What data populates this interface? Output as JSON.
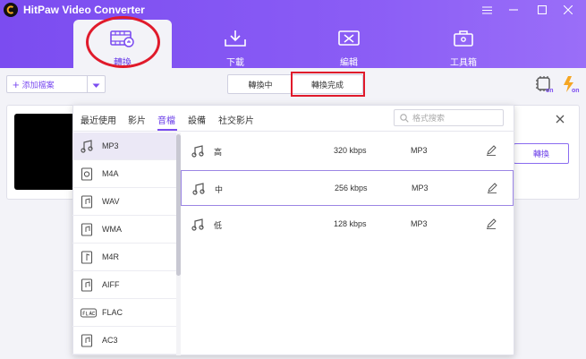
{
  "app": {
    "title": "HitPaw Video Converter"
  },
  "nav": {
    "tabs": [
      {
        "label": "轉換",
        "icon": "convert-film-icon",
        "active": true
      },
      {
        "label": "下載",
        "icon": "download-tray-icon",
        "active": false
      },
      {
        "label": "編輯",
        "icon": "edit-scissors-icon",
        "active": false
      },
      {
        "label": "工具箱",
        "icon": "toolbox-icon",
        "active": false
      }
    ]
  },
  "toolbar": {
    "add_file_label": "添加檔案",
    "segments": [
      "轉換中",
      "轉換完成"
    ],
    "active_segment": "轉換完成"
  },
  "card": {
    "convert_label": "轉換"
  },
  "format_popup": {
    "tabs": [
      "最近使用",
      "影片",
      "音檔",
      "設備",
      "社交影片"
    ],
    "active_tab": "音檔",
    "search_placeholder": "格式搜索",
    "formats": [
      {
        "name": "MP3",
        "icon": "music-note-icon",
        "active": true
      },
      {
        "name": "M4A",
        "icon": "m4a-file-icon",
        "active": false
      },
      {
        "name": "WAV",
        "icon": "wav-file-icon",
        "active": false
      },
      {
        "name": "WMA",
        "icon": "wma-file-icon",
        "active": false
      },
      {
        "name": "M4R",
        "icon": "m4r-file-icon",
        "active": false
      },
      {
        "name": "AIFF",
        "icon": "aiff-file-icon",
        "active": false
      },
      {
        "name": "FLAC",
        "icon": "flac-badge-icon",
        "active": false
      },
      {
        "name": "AC3",
        "icon": "ac3-file-icon",
        "active": false
      }
    ],
    "qualities": [
      {
        "name": "高",
        "bitrate": "320 kbps",
        "format": "MP3",
        "selected": false
      },
      {
        "name": "中",
        "bitrate": "256 kbps",
        "format": "MP3",
        "selected": true
      },
      {
        "name": "低",
        "bitrate": "128 kbps",
        "format": "MP3",
        "selected": false
      }
    ]
  },
  "colors": {
    "brand_purple": "#7b4cf0",
    "highlight_red": "#e01a2b"
  }
}
